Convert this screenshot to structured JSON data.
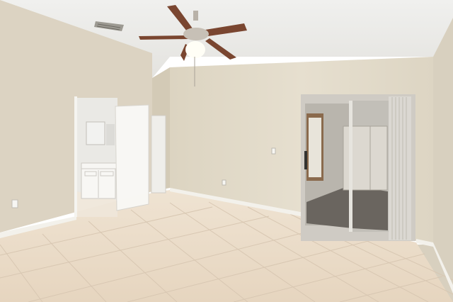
{
  "scene": {
    "subject": "empty-room-interior",
    "colors": {
      "ceiling": "#ececea",
      "wall_left": "#d8d0bf",
      "wall_back": "#e3dccb",
      "wall_right": "#ddd6c5",
      "floor": "#ebdcc9",
      "grout": "#d7c6b1",
      "baseboard": "#f4f2ec",
      "door": "#f7f6f2",
      "glass_outside": "#cfcac2",
      "blind": "#d9d6d0",
      "fan_blade": "#7d4a33",
      "fan_metal": "#b9b2a8",
      "fan_light": "#fffef6"
    }
  }
}
